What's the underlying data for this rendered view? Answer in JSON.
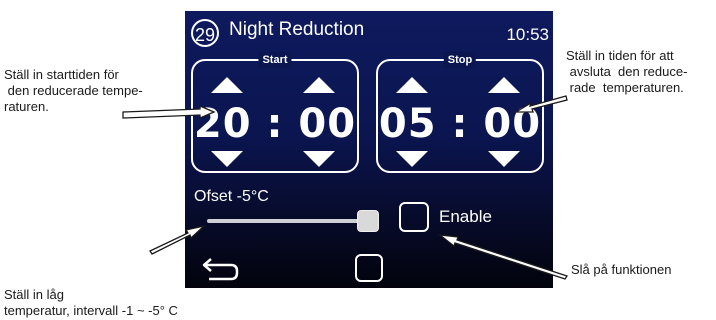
{
  "screen": {
    "title_number": "29",
    "title": "Night Reduction",
    "clock": "10:53",
    "start": {
      "label": "Start",
      "time": "20 : 00"
    },
    "stop": {
      "label": "Stop",
      "time": "05 : 00"
    },
    "offset": {
      "label": "Ofset -5°C",
      "slider_fraction": 1.0
    },
    "enable": {
      "label": "Enable",
      "checked": false
    },
    "icons": [
      "back-arrow-icon",
      "home-square-icon",
      "up-arrow-icon",
      "down-arrow-icon"
    ]
  },
  "annotations": {
    "start_note": "Ställ in starttiden för\n den reducerade tempe-\nraturen.",
    "stop_note": "Ställ in tiden för att\n avsluta  den reduce-\n rade  temperaturen.",
    "enable_note": "Slå på funktionen",
    "offset_note": "Ställ in låg\ntemperatur, intervall -1 ~ -5° C"
  },
  "colors": {
    "screen_top": "#0e1a5e",
    "screen_bottom": "#02030c",
    "foreground": "#ffffff"
  }
}
